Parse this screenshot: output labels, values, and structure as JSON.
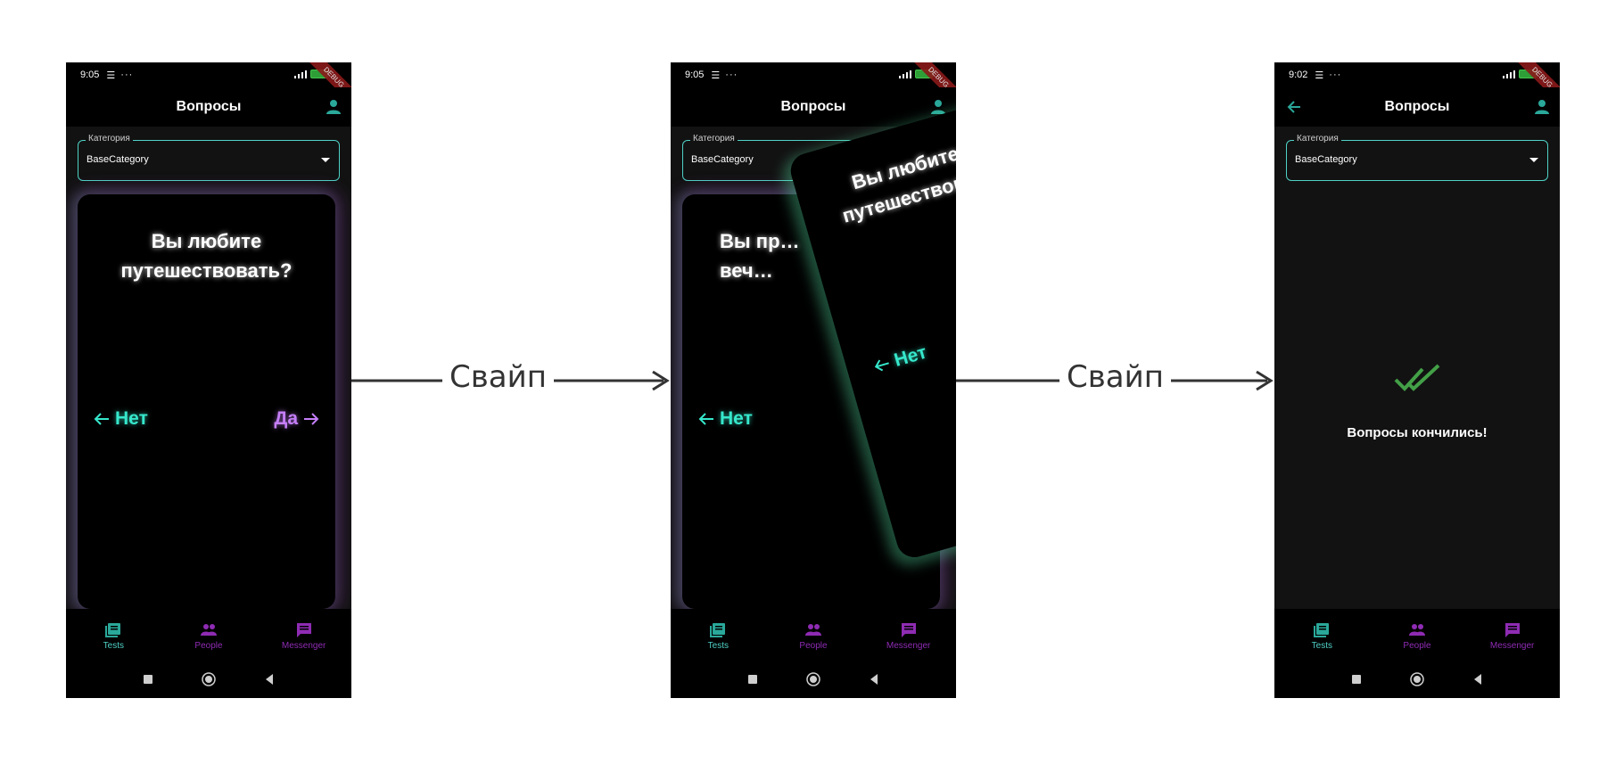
{
  "flow": {
    "step1_label": "Свайп",
    "step2_label": "Свайп"
  },
  "screens": [
    {
      "time": "9:05",
      "title": "Вопросы",
      "debug": "DEBUG",
      "category_label": "Категория",
      "category_value": "BaseCategory",
      "card_question": "Вы любите путешествовать?",
      "no_label": "Нет",
      "yes_label": "Да"
    },
    {
      "time": "9:05",
      "title": "Вопросы",
      "debug": "DEBUG",
      "category_label": "Категория",
      "category_value": "BaseCategory",
      "back_card_question": "Вы пр… веч…",
      "back_no_label": "Нет",
      "front_card_question": "Вы любите путешествов…",
      "front_no_label": "Нет"
    },
    {
      "time": "9:02",
      "title": "Вопросы",
      "debug": "DEBUG",
      "category_label": "Категория",
      "category_value": "BaseCategory",
      "done_text": "Вопросы кончились!"
    }
  ],
  "nav": {
    "tests": "Tests",
    "people": "People",
    "messenger": "Messenger"
  },
  "colors": {
    "accent_teal": "#4fd1c5",
    "accent_purple": "#8e2bb3",
    "yes_purple": "#c57ef8",
    "no_teal": "#36e7cb",
    "check_green": "#43a047"
  },
  "icons": {
    "person": "person-icon",
    "back": "arrow-back-icon",
    "tests": "library-books-icon",
    "people": "people-icon",
    "messenger": "message-icon",
    "done": "done-all-icon"
  }
}
